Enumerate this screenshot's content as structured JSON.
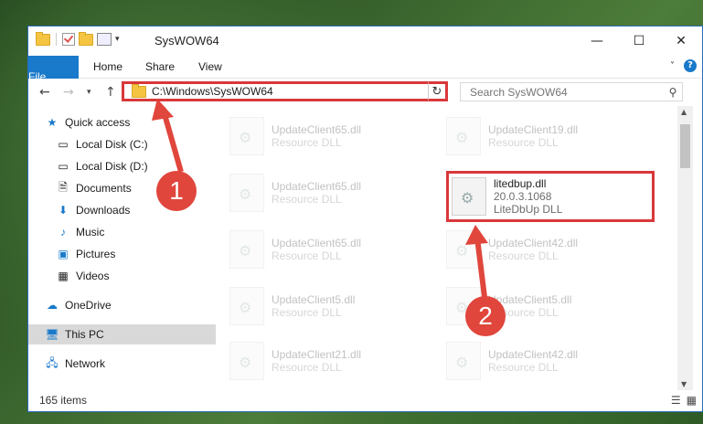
{
  "window": {
    "title": "SysWOW64"
  },
  "ribbon": {
    "tabs": [
      "File",
      "Home",
      "Share",
      "View"
    ]
  },
  "address": {
    "path": "C:\\Windows\\SysWOW64"
  },
  "search": {
    "placeholder": "Search SysWOW64"
  },
  "sidebar": {
    "items": [
      {
        "label": "Quick access",
        "icon": "star-icon"
      },
      {
        "label": "Local Disk (C:)",
        "icon": "drive-icon"
      },
      {
        "label": "Local Disk (D:)",
        "icon": "drive-icon"
      },
      {
        "label": "Documents",
        "icon": "documents-icon"
      },
      {
        "label": "Downloads",
        "icon": "download-icon"
      },
      {
        "label": "Music",
        "icon": "music-icon"
      },
      {
        "label": "Pictures",
        "icon": "pictures-icon"
      },
      {
        "label": "Videos",
        "icon": "videos-icon"
      },
      {
        "label": "OneDrive",
        "icon": "cloud-icon"
      },
      {
        "label": "This PC",
        "icon": "computer-icon"
      },
      {
        "label": "Network",
        "icon": "network-icon"
      }
    ]
  },
  "files": [
    {
      "name": "UpdateClient65.dll",
      "desc": "Resource DLL"
    },
    {
      "name": "UpdateClient19.dll",
      "desc": "Resource DLL"
    },
    {
      "name": "UpdateClient65.dll",
      "desc": "Resource DLL"
    },
    {
      "name": "UpdateClient65.dll",
      "desc": "Resource DLL"
    },
    {
      "name": "UpdateClient42.dll",
      "desc": "Resource DLL"
    },
    {
      "name": "UpdateClient5.dll",
      "desc": "Resource DLL"
    },
    {
      "name": "UpdateClient5.dll",
      "desc": "Resource DLL"
    },
    {
      "name": "UpdateClient21.dll",
      "desc": "Resource DLL"
    },
    {
      "name": "UpdateClient42.dll",
      "desc": "Resource DLL"
    }
  ],
  "highlighted_file": {
    "name": "litedbup.dll",
    "version": "20.0.3.1068",
    "desc": "LiteDbUp DLL"
  },
  "status": {
    "item_count": "165 items"
  },
  "callouts": {
    "one": "1",
    "two": "2"
  },
  "colors": {
    "accent": "#1979ca",
    "highlight": "#d9383a",
    "callout": "#e0463c"
  }
}
